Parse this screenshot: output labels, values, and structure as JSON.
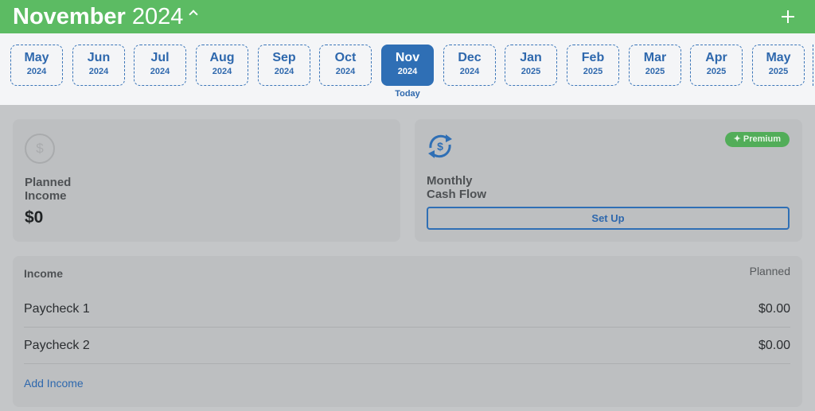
{
  "header": {
    "month": "November",
    "year": "2024",
    "add_icon": "plus-icon",
    "expand_icon": "chevron-up-icon"
  },
  "months": [
    {
      "name": "May",
      "year": "2024"
    },
    {
      "name": "Jun",
      "year": "2024"
    },
    {
      "name": "Jul",
      "year": "2024"
    },
    {
      "name": "Aug",
      "year": "2024"
    },
    {
      "name": "Sep",
      "year": "2024"
    },
    {
      "name": "Oct",
      "year": "2024"
    },
    {
      "name": "Nov",
      "year": "2024",
      "selected": true
    },
    {
      "name": "Dec",
      "year": "2024"
    },
    {
      "name": "Jan",
      "year": "2025"
    },
    {
      "name": "Feb",
      "year": "2025"
    },
    {
      "name": "Mar",
      "year": "2025"
    },
    {
      "name": "Apr",
      "year": "2025"
    },
    {
      "name": "May",
      "year": "2025"
    }
  ],
  "today_label": "Today",
  "planned_income_card": {
    "label_line1": "Planned",
    "label_line2": "Income",
    "value": "$0",
    "icon": "dollar-circle-icon"
  },
  "cash_flow_card": {
    "label_line1": "Monthly",
    "label_line2": "Cash Flow",
    "badge": "✦ Premium",
    "button": "Set Up",
    "icon": "cash-flow-cycle-icon"
  },
  "income_list": {
    "title": "Income",
    "column_label": "Planned",
    "rows": [
      {
        "name": "Paycheck 1",
        "amount": "$0.00"
      },
      {
        "name": "Paycheck 2",
        "amount": "$0.00"
      }
    ],
    "add_link": "Add Income"
  },
  "colors": {
    "header_green": "#5cbb63",
    "accent_blue": "#2f6fb5",
    "premium_green": "#52ad59",
    "overlay_gray": "#c4c6c8"
  }
}
